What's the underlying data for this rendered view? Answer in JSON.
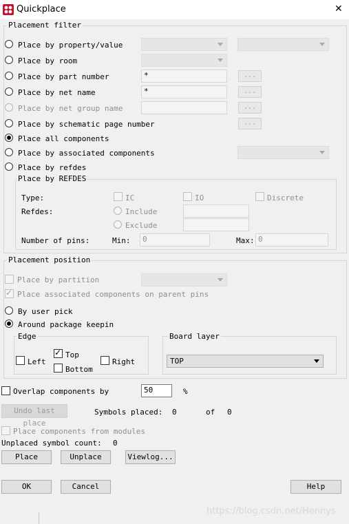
{
  "window": {
    "title": "Quickplace",
    "close_glyph": "✕"
  },
  "placement_filter": {
    "group_label": "Placement filter",
    "options": [
      {
        "label": "Place by property/value"
      },
      {
        "label": "Place by room"
      },
      {
        "label": "Place by part number",
        "value": "*",
        "browse": "..."
      },
      {
        "label": "Place by net name",
        "value": "*",
        "browse": "..."
      },
      {
        "label": "Place by net group name",
        "browse": "..."
      },
      {
        "label": "Place by schematic page number",
        "browse": "..."
      },
      {
        "label": "Place all components"
      },
      {
        "label": "Place by associated components"
      },
      {
        "label": "Place by refdes"
      }
    ],
    "selected_index": 6,
    "refdes_group": {
      "label": "Place by REFDES",
      "type_label": "Type:",
      "type_ic": "IC",
      "type_io": "IO",
      "type_discrete": "Discrete",
      "refdes_label": "Refdes:",
      "include": "Include",
      "exclude": "Exclude",
      "pins_label": "Number of pins:",
      "min_label": "Min:",
      "min_value": "0",
      "max_label": "Max:",
      "max_value": "0"
    }
  },
  "placement_position": {
    "group_label": "Placement position",
    "by_partition": "Place by partition",
    "associated_parent_pins": "Place associated components on parent pins",
    "by_user_pick": "By user pick",
    "around_keepin": "Around package keepin",
    "position_selected": "Around package keepin",
    "edge": {
      "label": "Edge",
      "left": "Left",
      "top": "Top",
      "bottom": "Bottom",
      "right": "Right",
      "top_checked": true
    },
    "board_layer": {
      "label": "Board layer",
      "value": "TOP"
    }
  },
  "overlap": {
    "label": "Overlap components by",
    "value": "50",
    "unit": "%"
  },
  "undo_button": "Undo last place",
  "symbols_placed": {
    "label": "Symbols placed:",
    "count": "0",
    "of_label": "of",
    "total": "0"
  },
  "from_modules": "Place components from modules",
  "unplaced": {
    "label": "Unplaced symbol count:",
    "count": "0"
  },
  "action_buttons": {
    "place": "Place",
    "unplace": "Unplace",
    "viewlog": "Viewlog..."
  },
  "dialog_buttons": {
    "ok": "OK",
    "cancel": "Cancel",
    "help": "Help"
  },
  "watermark": "https://blog.csdn.net/Hennys",
  "colors": {
    "background": "#f0f0f0",
    "titlebar": "#ffffff",
    "disabled_text": "#8f8f8f"
  }
}
